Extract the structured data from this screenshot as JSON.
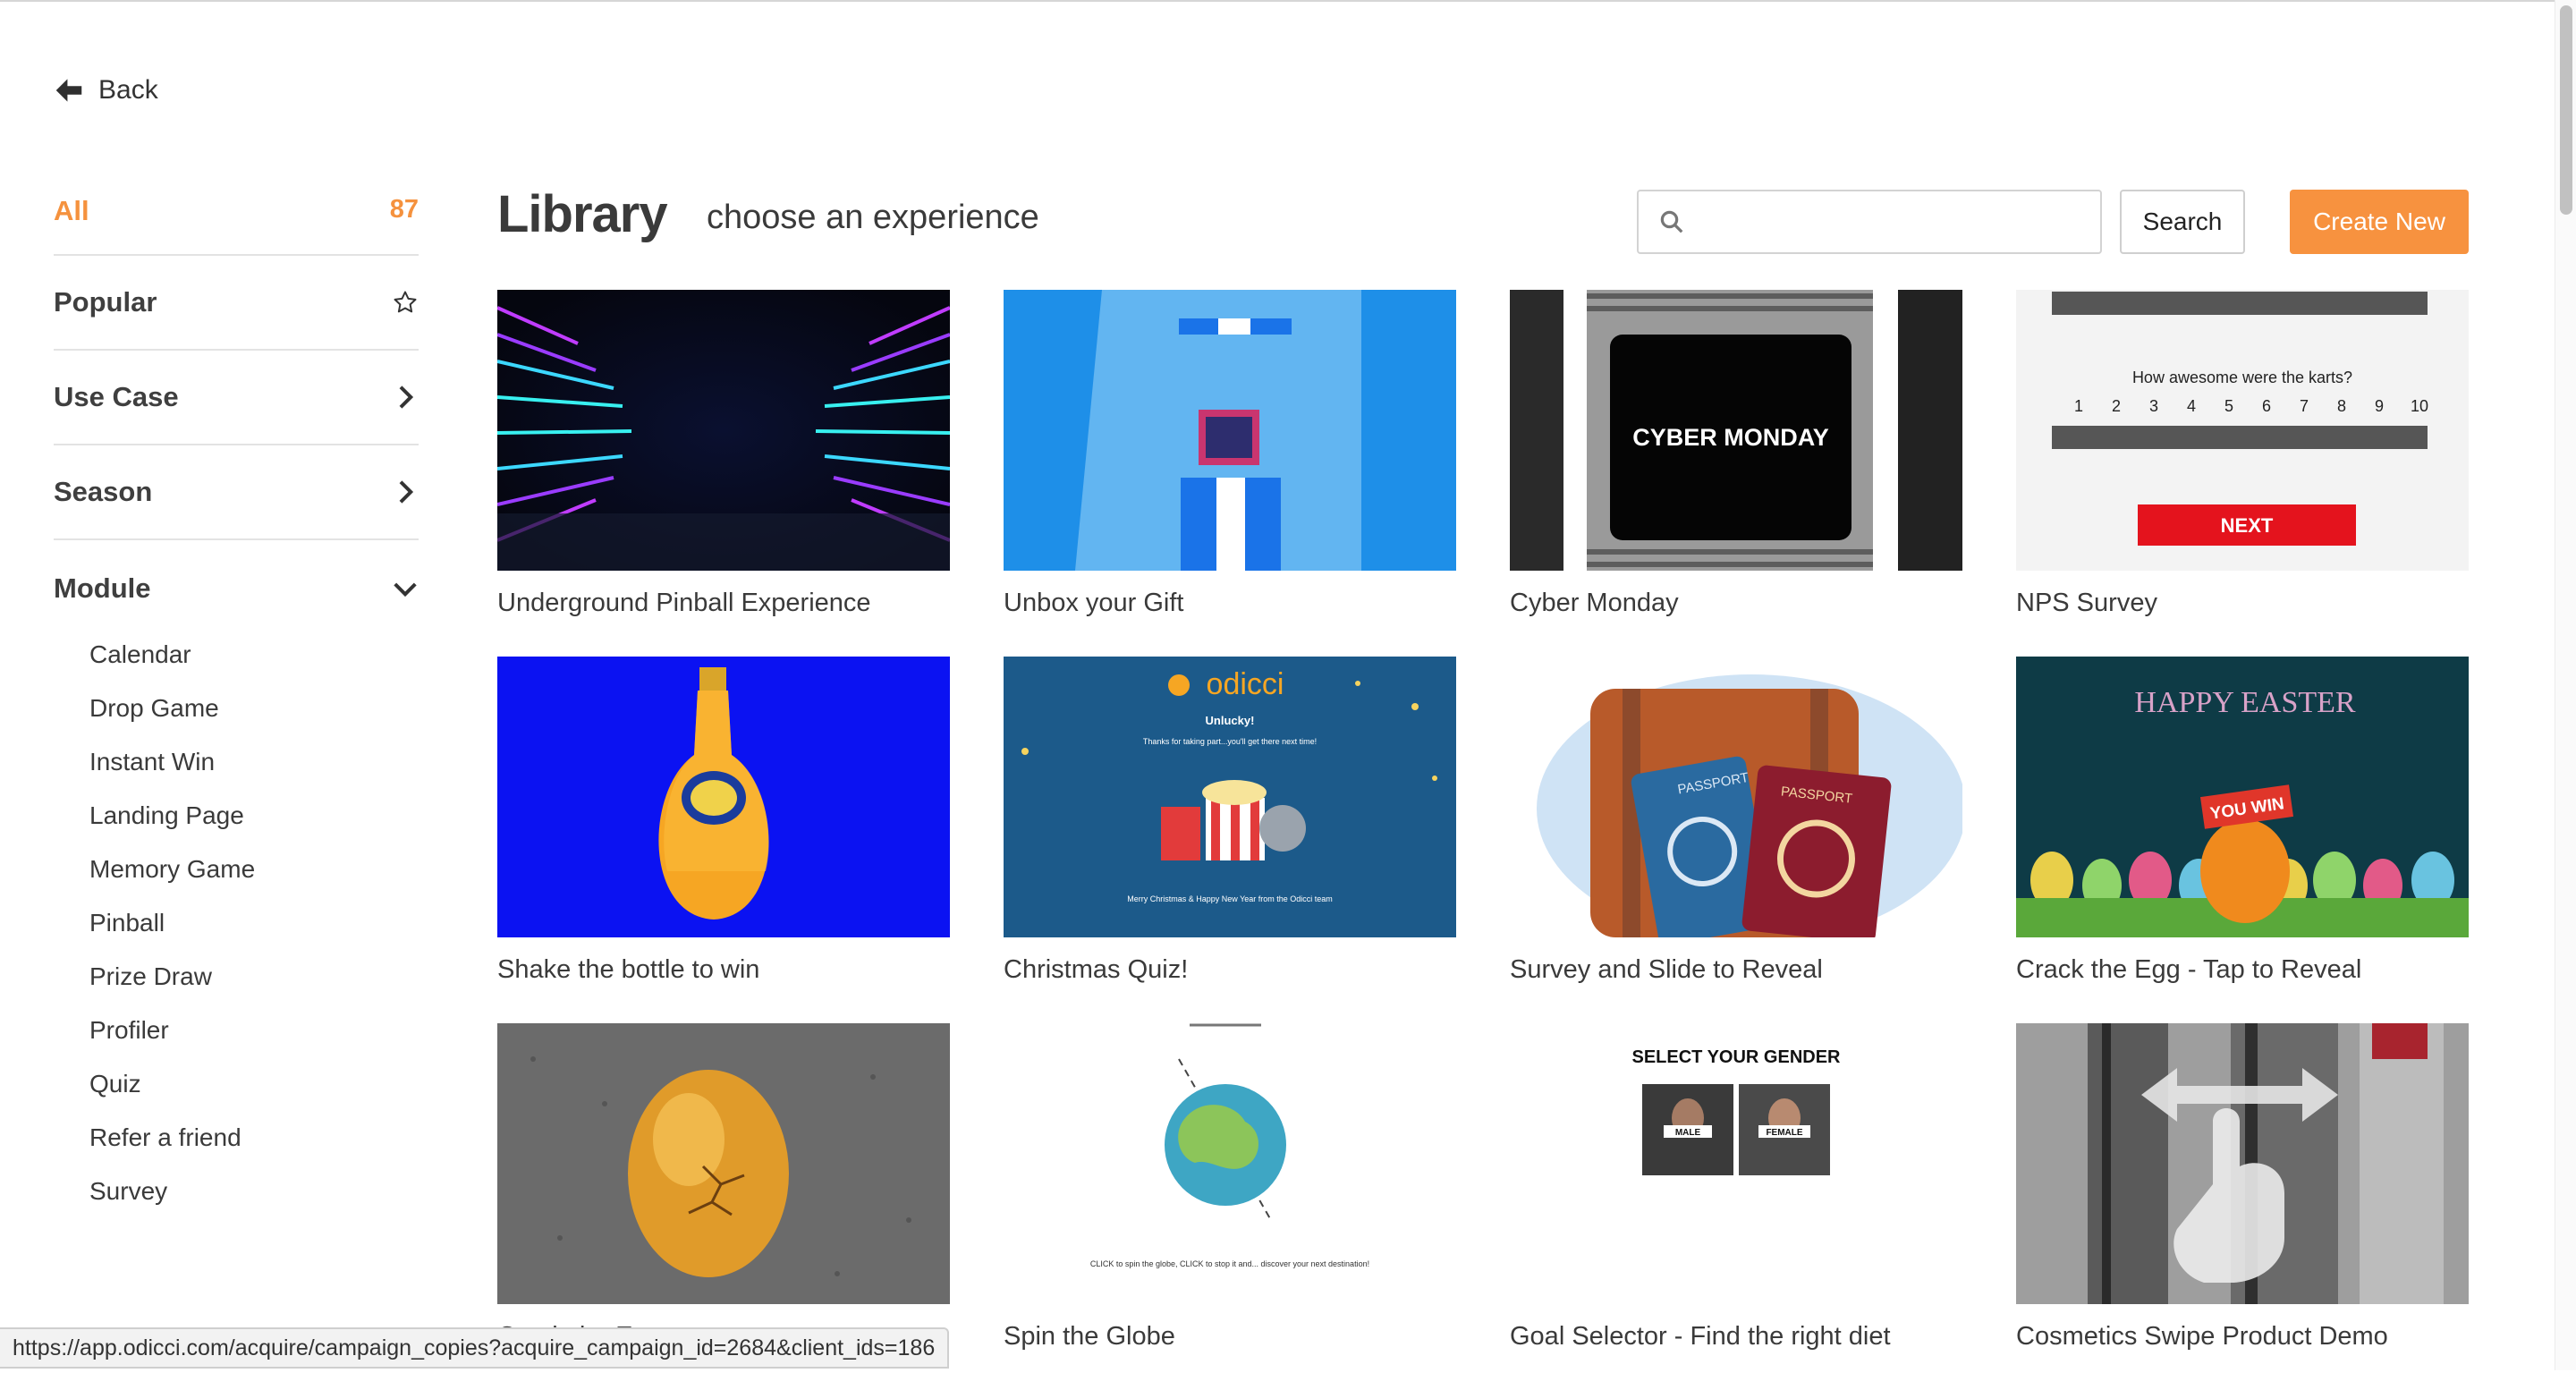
{
  "nav": {
    "back_label": "Back"
  },
  "sidebar": {
    "all": {
      "label": "All",
      "count": "87"
    },
    "categories": [
      {
        "label": "Popular",
        "icon": "star-icon"
      },
      {
        "label": "Use Case",
        "icon": "chevron-right-icon"
      },
      {
        "label": "Season",
        "icon": "chevron-right-icon"
      },
      {
        "label": "Module",
        "icon": "chevron-down-icon"
      }
    ],
    "module_items": [
      "Calendar",
      "Drop Game",
      "Instant Win",
      "Landing Page",
      "Memory Game",
      "Pinball",
      "Prize Draw",
      "Profiler",
      "Quiz",
      "Refer a friend",
      "Survey"
    ]
  },
  "header": {
    "title": "Library",
    "subtitle": "choose an experience",
    "search_placeholder": "",
    "search_button": "Search",
    "create_button": "Create New"
  },
  "cards": [
    {
      "title": "Underground Pinball Experience"
    },
    {
      "title": "Unbox your Gift"
    },
    {
      "title": "Cyber Monday",
      "thumb_text": "CYBER MONDAY"
    },
    {
      "title": "NPS Survey",
      "thumb_text": "How awesome were the karts?",
      "scale": [
        "1",
        "2",
        "3",
        "4",
        "5",
        "6",
        "7",
        "8",
        "9",
        "10"
      ],
      "button": "NEXT"
    },
    {
      "title": "Shake the bottle to win"
    },
    {
      "title": "Christmas Quiz!",
      "logo": "odicci",
      "heading": "Unlucky!",
      "line1": "Thanks for taking part...you'll get there next time!",
      "footer": "Merry Christmas & Happy New Year from the Odicci team"
    },
    {
      "title": "Survey and Slide to Reveal",
      "passport": "PASSPORT"
    },
    {
      "title": "Crack the Egg - Tap to Reveal",
      "heading": "HAPPY EASTER",
      "badge": "YOU WIN"
    },
    {
      "title": "Crack the Egg"
    },
    {
      "title": "Spin the Globe",
      "caption": "CLICK to spin the globe, CLICK to stop it and... discover your next destination!"
    },
    {
      "title": "Goal Selector - Find the right diet",
      "heading": "SELECT YOUR GENDER",
      "option1": "MALE",
      "option2": "FEMALE"
    },
    {
      "title": "Cosmetics Swipe Product Demo"
    }
  ],
  "status_url": "https://app.odicci.com/acquire/campaign_copies?acquire_campaign_id=2684&client_ids=186",
  "colors": {
    "accent": "#f7923f",
    "text": "#3a3a3a",
    "divider": "#e3e3e3"
  }
}
